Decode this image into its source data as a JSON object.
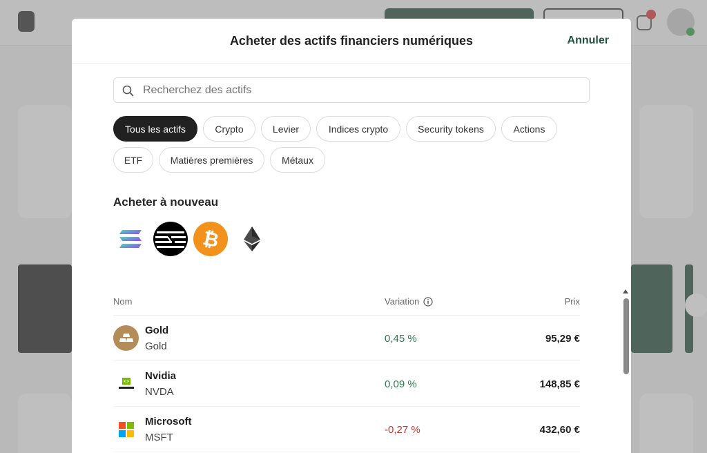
{
  "modal": {
    "title": "Acheter des actifs financiers numériques",
    "cancel_label": "Annuler"
  },
  "search": {
    "placeholder": "Recherchez des actifs",
    "icon": "search-icon"
  },
  "filters": [
    {
      "label": "Tous les actifs",
      "active": true
    },
    {
      "label": "Crypto",
      "active": false
    },
    {
      "label": "Levier",
      "active": false
    },
    {
      "label": "Indices crypto",
      "active": false
    },
    {
      "label": "Security tokens",
      "active": false
    },
    {
      "label": "Actions",
      "active": false
    },
    {
      "label": "ETF",
      "active": false
    },
    {
      "label": "Matières premières",
      "active": false
    },
    {
      "label": "Métaux",
      "active": false
    }
  ],
  "rebuy": {
    "title": "Acheter à nouveau",
    "assets": [
      {
        "icon": "solana-icon"
      },
      {
        "icon": "aptos-icon"
      },
      {
        "icon": "bitcoin-icon"
      },
      {
        "icon": "ethereum-icon"
      }
    ]
  },
  "table": {
    "headers": {
      "name": "Nom",
      "variation": "Variation",
      "price": "Prix"
    },
    "rows": [
      {
        "name": "Gold",
        "ticker": "Gold",
        "change": "0,45 %",
        "trend": "up",
        "price": "95,29 €",
        "icon": "gold-bars-icon"
      },
      {
        "name": "Nvidia",
        "ticker": "NVDA",
        "change": "0,09 %",
        "trend": "up",
        "price": "148,85 €",
        "icon": "nvidia-logo-icon"
      },
      {
        "name": "Microsoft",
        "ticker": "MSFT",
        "change": "-0,27 %",
        "trend": "down",
        "price": "432,60 €",
        "icon": "microsoft-logo-icon"
      }
    ]
  },
  "colors": {
    "accent": "#21523c",
    "positive": "#2f7a4f",
    "negative": "#c0392b",
    "active_chip": "#212121"
  }
}
